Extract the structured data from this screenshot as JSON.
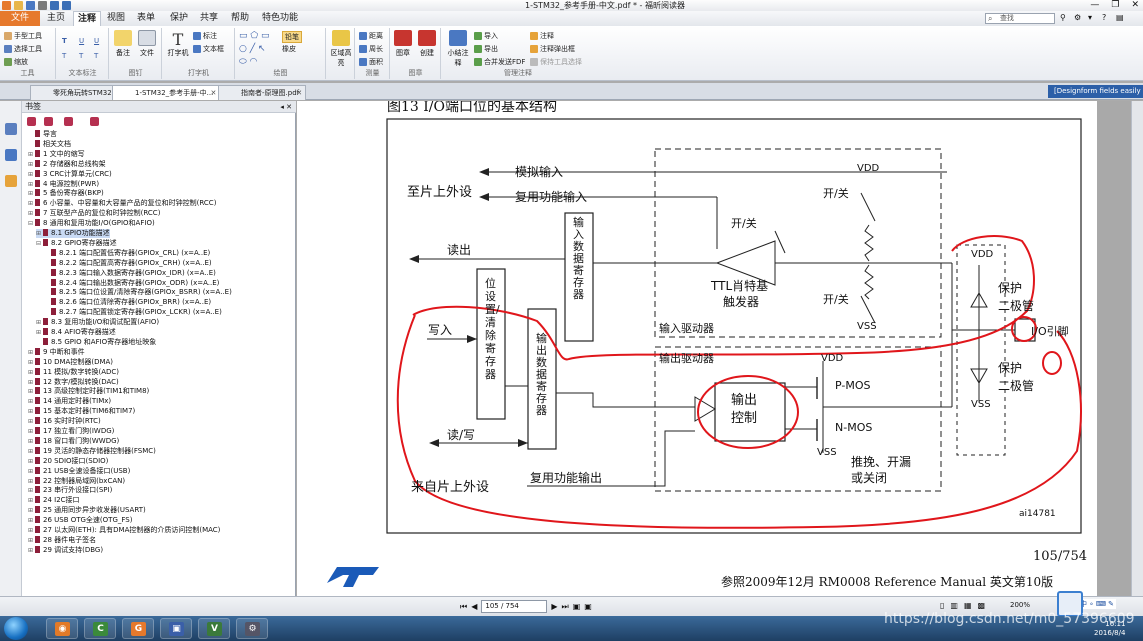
{
  "window": {
    "title": "1-STM32_参考手册-中文.pdf * - 福昕阅读器"
  },
  "menu": {
    "file": "文件",
    "tabs": [
      "主页",
      "注释",
      "视图",
      "表单",
      "保护",
      "共享",
      "帮助",
      "特色功能"
    ],
    "active_tab": "注释",
    "search_placeholder": "查找"
  },
  "ribbon": {
    "tools_group": {
      "label": "工具",
      "items": [
        "手型工具",
        "选择工具",
        "缩放"
      ]
    },
    "text_markup_group": {
      "label": "文本标注",
      "items": [
        "T",
        "U",
        "U",
        "T",
        "T",
        "T"
      ]
    },
    "pin_group": {
      "label": "图钉",
      "items": [
        "备注",
        "文件"
      ]
    },
    "typewriter_group": {
      "label": "打字机",
      "items": [
        "打字机",
        "标注",
        "文本框"
      ]
    },
    "drawing_group": {
      "label": "绘图",
      "items": [
        "铅笔",
        "橡皮"
      ]
    },
    "area_button": "区域高亮",
    "measure_group": {
      "label": "测量",
      "items": [
        "距离",
        "周长",
        "面积"
      ]
    },
    "stamp_group": {
      "label": "图章",
      "items": [
        "图章",
        "创建"
      ]
    },
    "manage_group": {
      "label": "管理注释",
      "items": [
        "小结注释",
        "导入",
        "导出",
        "合并发送FDF",
        "注释",
        "注释弹出框",
        "保持工具选择"
      ]
    }
  },
  "doc_tabs": [
    {
      "label": "零死角玩转STM32—F...",
      "active": false
    },
    {
      "label": "1-STM32_参考手册-中...",
      "active": true
    },
    {
      "label": "指南者-原理图.pdf",
      "active": false
    }
  ],
  "instance_banner": "[Designform fields easily",
  "bookmarks": {
    "header": "书签",
    "items": [
      {
        "label": "导言",
        "level": 0,
        "expander": ""
      },
      {
        "label": "相关文档",
        "level": 0,
        "expander": ""
      },
      {
        "label": "1 文中的缩写",
        "level": 0,
        "expander": "+"
      },
      {
        "label": "2 存储器和总线构架",
        "level": 0,
        "expander": "+"
      },
      {
        "label": "3 CRC计算单元(CRC)",
        "level": 0,
        "expander": "+"
      },
      {
        "label": "4 电源控制(PWR)",
        "level": 0,
        "expander": "+"
      },
      {
        "label": "5 备份寄存器(BKP)",
        "level": 0,
        "expander": "+"
      },
      {
        "label": "6 小容量、中容量和大容量产品的复位和时钟控制(RCC)",
        "level": 0,
        "expander": "+"
      },
      {
        "label": "7 互联型产品的复位和时钟控制(RCC)",
        "level": 0,
        "expander": "+"
      },
      {
        "label": "8 通用和复用功能I/O(GPIO和AFIO)",
        "level": 0,
        "expander": "-"
      },
      {
        "label": "8.1 GPIO功能描述",
        "level": 1,
        "expander": "+",
        "selected": true
      },
      {
        "label": "8.2 GPIO寄存器描述",
        "level": 1,
        "expander": "-"
      },
      {
        "label": "8.2.1 端口配置低寄存器(GPIOx_CRL) (x=A..E)",
        "level": 2,
        "expander": ""
      },
      {
        "label": "8.2.2 端口配置高寄存器(GPIOx_CRH) (x=A..E)",
        "level": 2,
        "expander": ""
      },
      {
        "label": "8.2.3 端口输入数据寄存器(GPIOx_IDR) (x=A..E)",
        "level": 2,
        "expander": ""
      },
      {
        "label": "8.2.4 端口输出数据寄存器(GPIOx_ODR) (x=A..E)",
        "level": 2,
        "expander": ""
      },
      {
        "label": "8.2.5 端口位设置/清除寄存器(GPIOx_BSRR) (x=A..E)",
        "level": 2,
        "expander": ""
      },
      {
        "label": "8.2.6 端口位清除寄存器(GPIOx_BRR) (x=A..E)",
        "level": 2,
        "expander": ""
      },
      {
        "label": "8.2.7 端口配置锁定寄存器(GPIOx_LCKR) (x=A..E)",
        "level": 2,
        "expander": ""
      },
      {
        "label": "8.3 复用功能I/O和调试配置(AFIO)",
        "level": 1,
        "expander": "+"
      },
      {
        "label": "8.4 AFIO寄存器描述",
        "level": 1,
        "expander": "+"
      },
      {
        "label": "8.5 GPIO 和AFIO寄存器地址映象",
        "level": 1,
        "expander": ""
      },
      {
        "label": "9 中断和事件",
        "level": 0,
        "expander": "+"
      },
      {
        "label": "10 DMA控制器(DMA)",
        "level": 0,
        "expander": "+"
      },
      {
        "label": "11 模拟/数字转换(ADC)",
        "level": 0,
        "expander": "+"
      },
      {
        "label": "12 数字/模拟转换(DAC)",
        "level": 0,
        "expander": "+"
      },
      {
        "label": "13 高级控制定时器(TIM1和TIM8)",
        "level": 0,
        "expander": "+"
      },
      {
        "label": "14 通用定时器(TIMx)",
        "level": 0,
        "expander": "+"
      },
      {
        "label": "15 基本定时器(TIM6和TIM7)",
        "level": 0,
        "expander": "+"
      },
      {
        "label": "16 实时时钟(RTC)",
        "level": 0,
        "expander": "+"
      },
      {
        "label": "17 独立看门狗(IWDG)",
        "level": 0,
        "expander": "+"
      },
      {
        "label": "18 窗口看门狗(WWDG)",
        "level": 0,
        "expander": "+"
      },
      {
        "label": "19 灵活的静态存储器控制器(FSMC)",
        "level": 0,
        "expander": "+"
      },
      {
        "label": "20 SDIO接口(SDIO)",
        "level": 0,
        "expander": "+"
      },
      {
        "label": "21 USB全速设备接口(USB)",
        "level": 0,
        "expander": "+"
      },
      {
        "label": "22 控制器局域网(bxCAN)",
        "level": 0,
        "expander": "+"
      },
      {
        "label": "23 串行外设接口(SPI)",
        "level": 0,
        "expander": "+"
      },
      {
        "label": "24 I2C接口",
        "level": 0,
        "expander": "+"
      },
      {
        "label": "25 通用同步异步收发器(USART)",
        "level": 0,
        "expander": "+"
      },
      {
        "label": "26 USB OTG全速(OTG_FS)",
        "level": 0,
        "expander": "+"
      },
      {
        "label": "27 以太网(ETH): 具有DMA控制器的介质访问控制(MAC)",
        "level": 0,
        "expander": "+"
      },
      {
        "label": "28 器件电子签名",
        "level": 0,
        "expander": "+"
      },
      {
        "label": "29 调试支持(DBG)",
        "level": 0,
        "expander": "+"
      }
    ]
  },
  "page": {
    "figure_title": "图13    I/O端口位的基本结构",
    "page_number": "105/754",
    "footer": "参照2009年12月 RM0008 Reference Manual  英文第10版",
    "figure_id": "ai14781"
  },
  "diagram": {
    "to_onchip": "至片上外设",
    "from_onchip": "来自片上外设",
    "analog_input": "模拟输入",
    "alt_input": "复用功能输入",
    "read": "读出",
    "write": "写入",
    "read_write": "读/写",
    "alt_output": "复用功能输出",
    "bsrr": "位设置/清除寄存器",
    "input_data_reg": "输入数据寄存器",
    "output_data_reg": "输出数据寄存器",
    "input_driver": "输入驱动器",
    "output_driver": "输出驱动器",
    "on_off_1": "开/关",
    "on_off_2": "开/关",
    "on_off_3": "开/关",
    "ttl_schmitt_1": "TTL肖特基",
    "ttl_schmitt_2": "触发器",
    "vdd_1": "VDD",
    "vss_1": "VSS",
    "vdd_2": "VDD",
    "vss_2": "VSS",
    "vdd_3": "VDD",
    "vss_3": "VSS",
    "output_control_1": "输出",
    "output_control_2": "控制",
    "pmos": "P-MOS",
    "nmos": "N-MOS",
    "mode_1": "推挽、开漏",
    "mode_2": "或关闭",
    "protect_1": "保护",
    "protect_diode_1": "二极管",
    "protect_2": "保护",
    "protect_diode_2": "二极管",
    "io_pin": "I/O引脚"
  },
  "navigation": {
    "page_value": "105 / 754",
    "zoom": "200%"
  },
  "watermark": "https://blog.csdn.net/m0_57396609",
  "taskbar": {
    "time": "16:11",
    "date": "2016/8/4"
  },
  "colors": {
    "accent": "#e6792c",
    "annotation_red": "#e0161b",
    "bookmark_flag": "#8d1f3a"
  }
}
